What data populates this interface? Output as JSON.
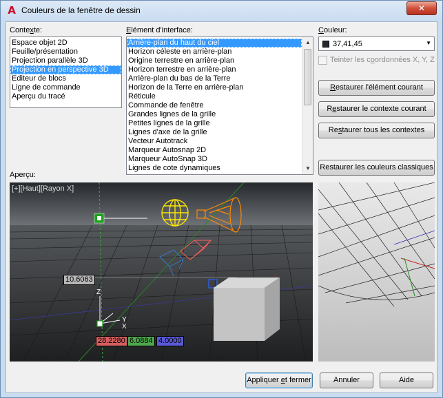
{
  "window": {
    "title": "Couleurs de la fenêtre de dessin",
    "close_symbol": "✕"
  },
  "context": {
    "label_pre": "Conte",
    "label_u": "x",
    "label_post": "te:",
    "items": [
      "Espace objet 2D",
      "Feuille/présentation",
      "Projection parallèle 3D",
      "Projection en perspective 3D",
      "Editeur de blocs",
      "Ligne de commande",
      "Aperçu du tracé"
    ],
    "selected_index": 3
  },
  "element": {
    "label_pre": "",
    "label_u": "E",
    "label_post": "lément d'interface:",
    "items": [
      "Arrière-plan du haut du ciel",
      "Horizon céleste en arrière-plan",
      "Origine terrestre en arrière-plan",
      "Horizon terrestre en arrière-plan",
      "Arrière-plan du bas de la Terre",
      "Horizon de la Terre en arrière-plan",
      "Réticule",
      "Commande de fenêtre",
      "Grandes lignes de la grille",
      "Petites lignes de la grille",
      "Lignes d'axe de la grille",
      "Vecteur Autotrack",
      "Marqueur Autosnap 2D",
      "Marqueur AutoSnap 3D",
      "Lignes de cote dynamiques"
    ],
    "selected_index": 0
  },
  "color": {
    "label_pre": "",
    "label_u": "C",
    "label_post": "ouleur:",
    "value": "37,41,45",
    "swatch": "#25292d",
    "tint_label_pre": "Teinter les c",
    "tint_label_u": "o",
    "tint_label_post": "ordonnées X, Y, Z",
    "tint_checked": false
  },
  "buttons": {
    "restore_element_pre": "",
    "restore_element_u": "R",
    "restore_element_post": "estaurer l'élément courant",
    "restore_context_pre": "R",
    "restore_context_u": "e",
    "restore_context_post": "staurer le contexte courant",
    "restore_all_pre": "Re",
    "restore_all_u": "s",
    "restore_all_post": "taurer tous les contextes",
    "restore_classic": "Restaurer les couleurs classiques",
    "apply_pre": "Appliquer ",
    "apply_u": "e",
    "apply_post": "t fermer",
    "cancel": "Annuler",
    "help": "Aide"
  },
  "preview": {
    "label": "Aperçu:",
    "viewport_label": "[+][Haut][Rayon X]",
    "dim_length": "10.6063",
    "coord_x": "28.2280",
    "coord_y": "6.0884",
    "coord_z": "4.0000",
    "axis_x": "X",
    "axis_y": "Y",
    "axis_z": "Z",
    "colors": {
      "coord_x_bg": "#d55e5e",
      "coord_y_bg": "#4fa84f",
      "coord_z_bg": "#5a5ad6",
      "dim_bg": "#b8b8b8"
    }
  }
}
